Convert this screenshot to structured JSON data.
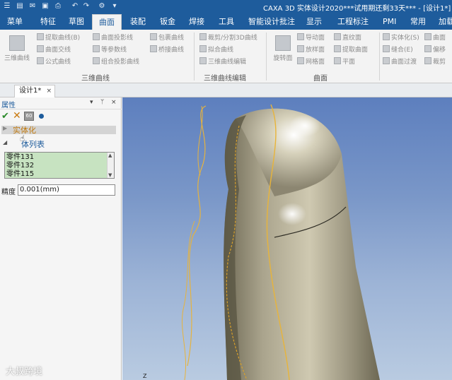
{
  "titlebar": {
    "title": "CAXA 3D 实体设计2020***试用期还剩33天*** - [设计1*]",
    "quick_access": [
      "menu-icon",
      "open-icon",
      "mail-icon",
      "save-icon",
      "print-icon",
      "undo-icon",
      "redo-icon",
      "dropdown-icon"
    ]
  },
  "menubar": {
    "tabs": [
      "菜单",
      "特征",
      "草图",
      "曲面",
      "装配",
      "钣金",
      "焊接",
      "工具",
      "智能设计批注",
      "显示",
      "工程标注",
      "PMI",
      "常用",
      "加载"
    ],
    "active_tab": "曲面"
  },
  "ribbon": {
    "groups": [
      {
        "label": "三维曲线",
        "big_button": "三维曲线",
        "items": [
          "提取曲线(B)",
          "曲面交线",
          "公式曲线",
          "曲面投影线",
          "等参数线",
          "组合投影曲线",
          "包裹曲线",
          "桥接曲线"
        ]
      },
      {
        "label": "三维曲线编辑",
        "items": [
          "裁剪/分割3D曲线",
          "拟合曲线",
          "三维曲线编辑",
          "三维曲线编辑"
        ]
      },
      {
        "label": "曲面",
        "big_button": "旋转面",
        "items": [
          "导动面",
          "放样面",
          "网格面",
          "直纹面",
          "提取曲面",
          "平面"
        ]
      },
      {
        "label": "",
        "items": [
          "实体化(S)",
          "缝合(E)",
          "曲面过渡",
          "曲面",
          "偏移",
          "裁剪"
        ]
      }
    ]
  },
  "document_tab": {
    "label": "设计1*",
    "close": "×"
  },
  "panel": {
    "title": "属性",
    "pin_controls": [
      "▾",
      "ᛘ",
      "×"
    ],
    "feature": "实体化",
    "section": "体列表",
    "bodies": [
      "零件131",
      "零件132",
      "零件115"
    ],
    "precision_label": "精度",
    "precision_value": "0.001(mm)"
  },
  "viewport": {
    "axis_label": "Z",
    "watermark": "大叔跨境"
  }
}
